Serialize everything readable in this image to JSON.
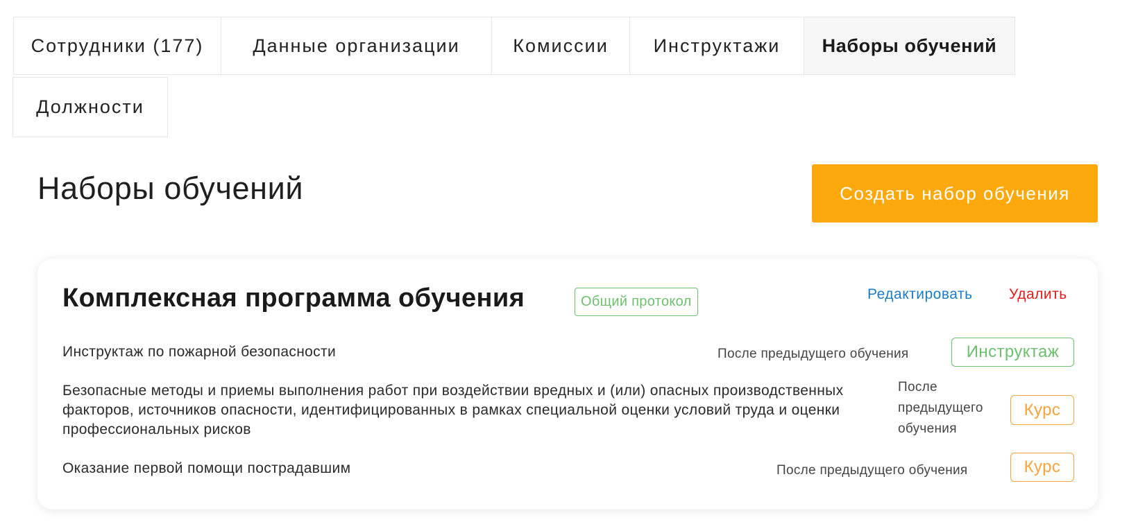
{
  "tabs": [
    {
      "label": "Сотрудники (177)",
      "active": false
    },
    {
      "label": "Данные организации",
      "active": false
    },
    {
      "label": "Комиссии",
      "active": false
    },
    {
      "label": "Инструктажи",
      "active": false
    },
    {
      "label": "Наборы обучений",
      "active": true
    },
    {
      "label": "Должности",
      "active": false
    }
  ],
  "header": {
    "title": "Наборы обучений",
    "create_button_label": "Создать набор обучения"
  },
  "training_set": {
    "title": "Комплексная программа обучения",
    "badge": "Общий протокол",
    "edit_label": "Редактировать",
    "delete_label": "Удалить",
    "items": [
      {
        "name": "Инструктаж по пожарной безопасности",
        "timing": "После предыдущего обучения",
        "type": "Инструктаж"
      },
      {
        "name": "Безопасные методы и приемы выполнения работ при воздействии вредных и (или) опасных производственных факторов, источников опасности, идентифицированных в рамках специальной оценки условий труда и оценки профессиональных рисков",
        "timing": "После предыдущего обучения",
        "type": "Курс"
      },
      {
        "name": "Оказание первой помощи пострадавшим",
        "timing": "После предыдущего обучения",
        "type": "Курс"
      }
    ]
  },
  "colors": {
    "accent_orange": "#fca90e",
    "badge_green": "#6cc06e",
    "badge_orange": "#f6a43c",
    "link_blue": "#1c7cc4",
    "delete_red": "#e21b1b"
  }
}
